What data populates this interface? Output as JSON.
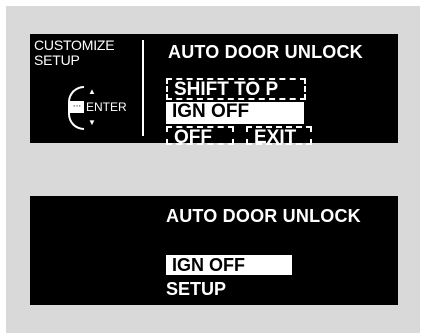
{
  "screen1": {
    "left_title_line1": "CUSTOMIZE",
    "left_title_line2": "SETUP",
    "up_arrow": "▲",
    "down_arrow": "▼",
    "enter_label": "ENTER",
    "header": "AUTO DOOR UNLOCK",
    "options": {
      "shift": "SHIFT TO P",
      "ign_off": "IGN OFF",
      "off": "OFF",
      "exit": "EXIT"
    },
    "selected": "IGN OFF",
    "icons": [
      "selector-knob-icon",
      "up-arrow-icon",
      "down-arrow-icon",
      "enter-button-icon"
    ]
  },
  "screen2": {
    "header": "AUTO DOOR UNLOCK",
    "selected_value": "IGN OFF",
    "setup_label": "SETUP"
  },
  "colors": {
    "screen_bg": "#000000",
    "text": "#ffffff",
    "highlight_bg": "#ffffff",
    "highlight_text": "#000000",
    "frame_bg": "#d9d9d9"
  }
}
